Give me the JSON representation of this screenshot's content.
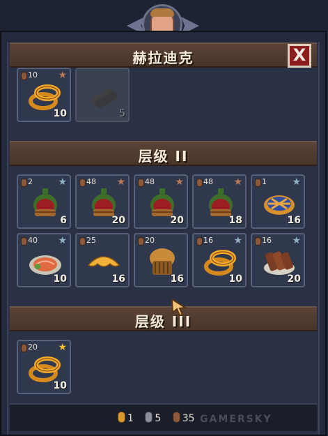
{
  "header": {
    "title": "赫拉迪克",
    "close_label": "X"
  },
  "sections": [
    {
      "title": ""
    },
    {
      "title": "层级 II"
    },
    {
      "title": "层级 III"
    }
  ],
  "top_items": [
    {
      "name": "onion-rings",
      "cost": "10",
      "star": "bronze",
      "qty": "10",
      "available": true
    },
    {
      "name": "firewood",
      "cost": "",
      "star": "",
      "qty": "5",
      "available": false
    }
  ],
  "tier2_items": [
    {
      "name": "red-wine-bottle",
      "cost": "2",
      "star": "silver",
      "qty": "6"
    },
    {
      "name": "red-wine-bottle",
      "cost": "48",
      "star": "bronze",
      "qty": "20"
    },
    {
      "name": "red-wine-bottle",
      "cost": "48",
      "star": "bronze",
      "qty": "20"
    },
    {
      "name": "red-wine-bottle",
      "cost": "48",
      "star": "bronze",
      "qty": "18"
    },
    {
      "name": "blueberry-pie",
      "cost": "1",
      "star": "silver",
      "qty": "16"
    },
    {
      "name": "salmon-plate",
      "cost": "40",
      "star": "silver",
      "qty": "10"
    },
    {
      "name": "croissant",
      "cost": "25",
      "star": "",
      "qty": "16"
    },
    {
      "name": "muffin",
      "cost": "20",
      "star": "",
      "qty": "16"
    },
    {
      "name": "onion-rings",
      "cost": "16",
      "star": "silver",
      "qty": "10"
    },
    {
      "name": "meat-slices",
      "cost": "16",
      "star": "silver",
      "qty": "20"
    }
  ],
  "tier3_items": [
    {
      "name": "onion-rings",
      "cost": "20",
      "star": "gold",
      "qty": "10"
    }
  ],
  "footer": {
    "gold": "1",
    "silver": "5",
    "bronze": "35"
  },
  "watermark": "GAMERSKY",
  "colors": {
    "gold": "#d89a2e",
    "silver": "#8a8f9a",
    "bronze": "#8b5a3c",
    "star_gold": "#f2c230",
    "star_silver": "#8fb4c4",
    "star_bronze": "#b87a56",
    "close_red": "#8b1d1d"
  }
}
